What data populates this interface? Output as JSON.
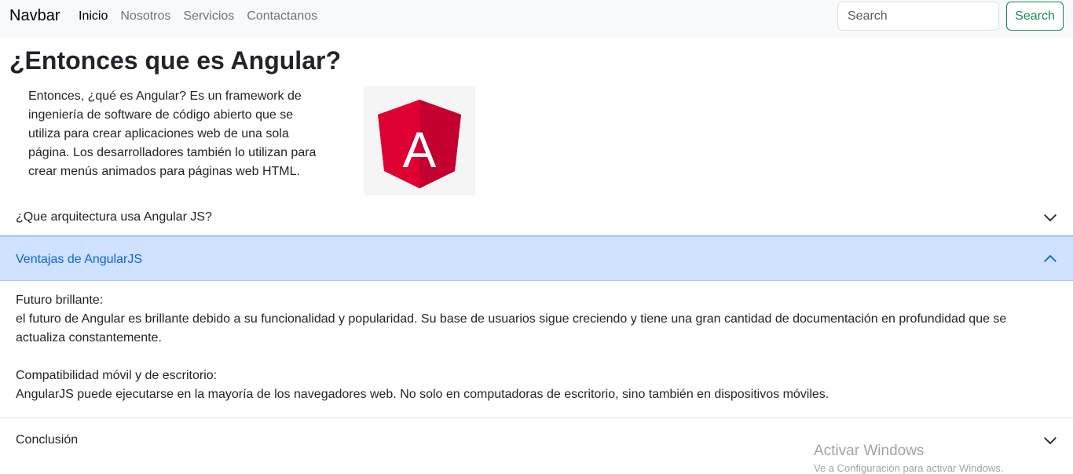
{
  "navbar": {
    "brand": "Navbar",
    "links": [
      "Inicio",
      "Nosotros",
      "Servicios",
      "Contactanos"
    ],
    "search_placeholder": "Search",
    "search_button": "Search"
  },
  "main": {
    "title": "¿Entonces que es Angular?",
    "intro": "Entonces, ¿qué es Angular? Es un framework de ingeniería de software de código abierto que se utiliza para crear aplicaciones web de una sola página. Los desarrolladores también lo utilizan para crear menús animados para páginas web HTML.",
    "logo_letter": "A"
  },
  "accordion": {
    "item1": "¿Que arquitectura usa Angular JS?",
    "item2": "Ventajas de AngularJS",
    "item2_body": {
      "h1": "Futuro brillante:",
      "p1": "el futuro de Angular es brillante debido a su funcionalidad y popularidad. Su base de usuarios sigue creciendo y tiene una gran cantidad de documentación en profundidad que se actualiza constantemente.",
      "h2": "Compatibilidad móvil y de escritorio:",
      "p2": "AngularJS puede ejecutarse en la mayoría de los navegadores web. No solo en computadoras de escritorio, sino también en dispositivos móviles."
    },
    "item3": "Conclusión"
  },
  "watermark": {
    "title": "Activar Windows",
    "subtitle": "Ve a Configuración para activar Windows."
  },
  "colors": {
    "accent_success": "#198754",
    "accordion_active_bg": "#cfe2ff",
    "accordion_active_text": "#0c63e4",
    "angular_red": "#dd0031"
  }
}
